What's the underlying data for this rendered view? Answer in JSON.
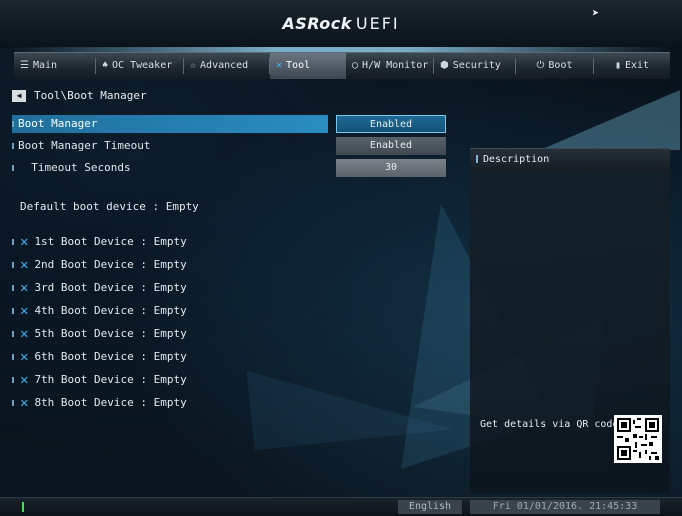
{
  "header": {
    "brand": "ASRock",
    "product": "UEFI"
  },
  "tabs": [
    {
      "label": "Main",
      "icon": "list-icon"
    },
    {
      "label": "OC Tweaker",
      "icon": "flame-icon"
    },
    {
      "label": "Advanced",
      "icon": "star-icon"
    },
    {
      "label": "Tool",
      "icon": "tools-icon",
      "active": true
    },
    {
      "label": "H/W Monitor",
      "icon": "monitor-icon"
    },
    {
      "label": "Security",
      "icon": "shield-icon"
    },
    {
      "label": "Boot",
      "icon": "power-icon"
    },
    {
      "label": "Exit",
      "icon": "exit-icon"
    }
  ],
  "breadcrumb": "Tool\\Boot Manager",
  "settings": {
    "boot_manager": {
      "label": "Boot Manager",
      "value": "Enabled"
    },
    "boot_manager_timeout": {
      "label": "Boot Manager Timeout",
      "value": "Enabled"
    },
    "timeout_seconds": {
      "label": "Timeout Seconds",
      "value": "30"
    }
  },
  "default_boot_device": "Default boot device : Empty",
  "boot_devices": [
    "1st Boot Device : Empty",
    "2nd Boot Device : Empty",
    "3rd Boot Device : Empty",
    "4th Boot Device : Empty",
    "5th Boot Device : Empty",
    "6th Boot Device : Empty",
    "7th Boot Device : Empty",
    "8th Boot Device : Empty"
  ],
  "description": {
    "title": "Description",
    "qr_label": "Get details via QR code"
  },
  "footer": {
    "language": "English",
    "datetime": "Fri 01/01/2016. 21:45:33"
  },
  "colors": {
    "accent": "#2a8cc0",
    "highlight": "#45b7f0",
    "status_mark": "#52d66a"
  }
}
